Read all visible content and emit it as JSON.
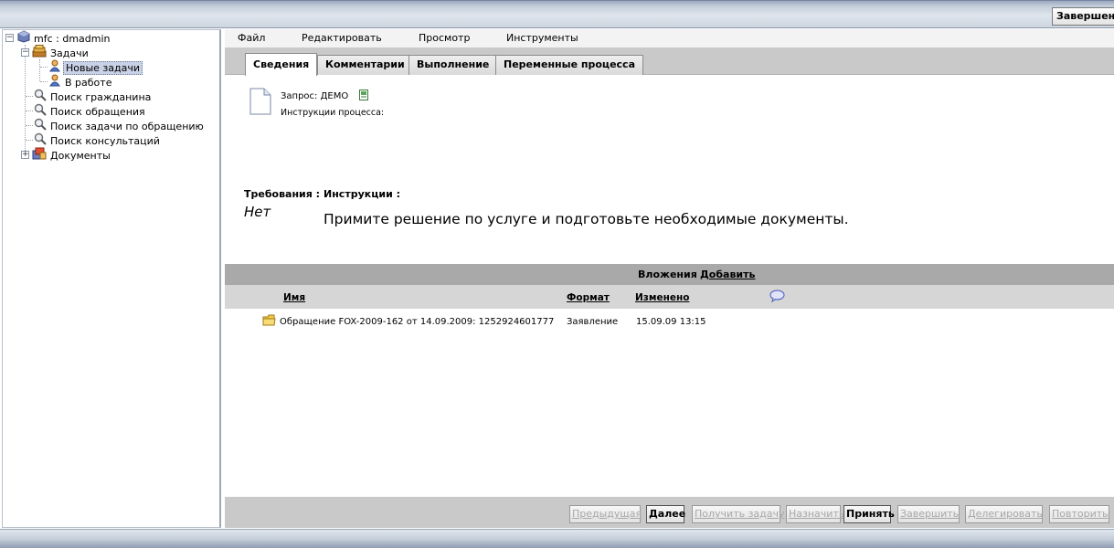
{
  "topbar": {
    "logout_label": "Завершени"
  },
  "tree": {
    "root_label": "mfc : dmadmin",
    "tasks_label": "Задачи",
    "new_tasks_label": "Новые задачи",
    "in_progress_label": "В работе",
    "search_citizen_label": "Поиск гражданина",
    "search_request_label": "Поиск обращения",
    "search_task_label": "Поиск задачи по обращению",
    "search_consult_label": "Поиск консультаций",
    "documents_label": "Документы"
  },
  "menu": {
    "file": "Файл",
    "edit": "Редактировать",
    "view": "Просмотр",
    "tools": "Инструменты"
  },
  "tabs": {
    "info": "Сведения",
    "comments": "Комментарии",
    "execution": "Выполнение",
    "process_vars": "Переменные процесса"
  },
  "details": {
    "request": "Запрос: ДЕМО",
    "process_instructions": "Инструкции процесса:",
    "requirements_label": "Требования :",
    "instructions_label": "Инструкции :",
    "requirements_value": "Нет",
    "instructions_value": "Примите решение по услуге и подготовьте необходимые документы."
  },
  "attachments": {
    "title": "Вложения",
    "add_label": "Добавить",
    "columns": {
      "name": "Имя",
      "format": "Формат",
      "modified": "Изменено"
    },
    "rows": [
      {
        "name": "Обращение FOX-2009-162 от 14.09.2009: 1252924601777",
        "format": "Заявление",
        "modified": "15.09.09 13:15"
      }
    ]
  },
  "actions": {
    "previous": "Предыдущая",
    "next": "Далее",
    "get_task": "Получить задачу",
    "assign": "Назначить",
    "accept": "Принять",
    "finish": "Завершить",
    "delegate": "Делегировать",
    "repeat": "Повторить"
  }
}
